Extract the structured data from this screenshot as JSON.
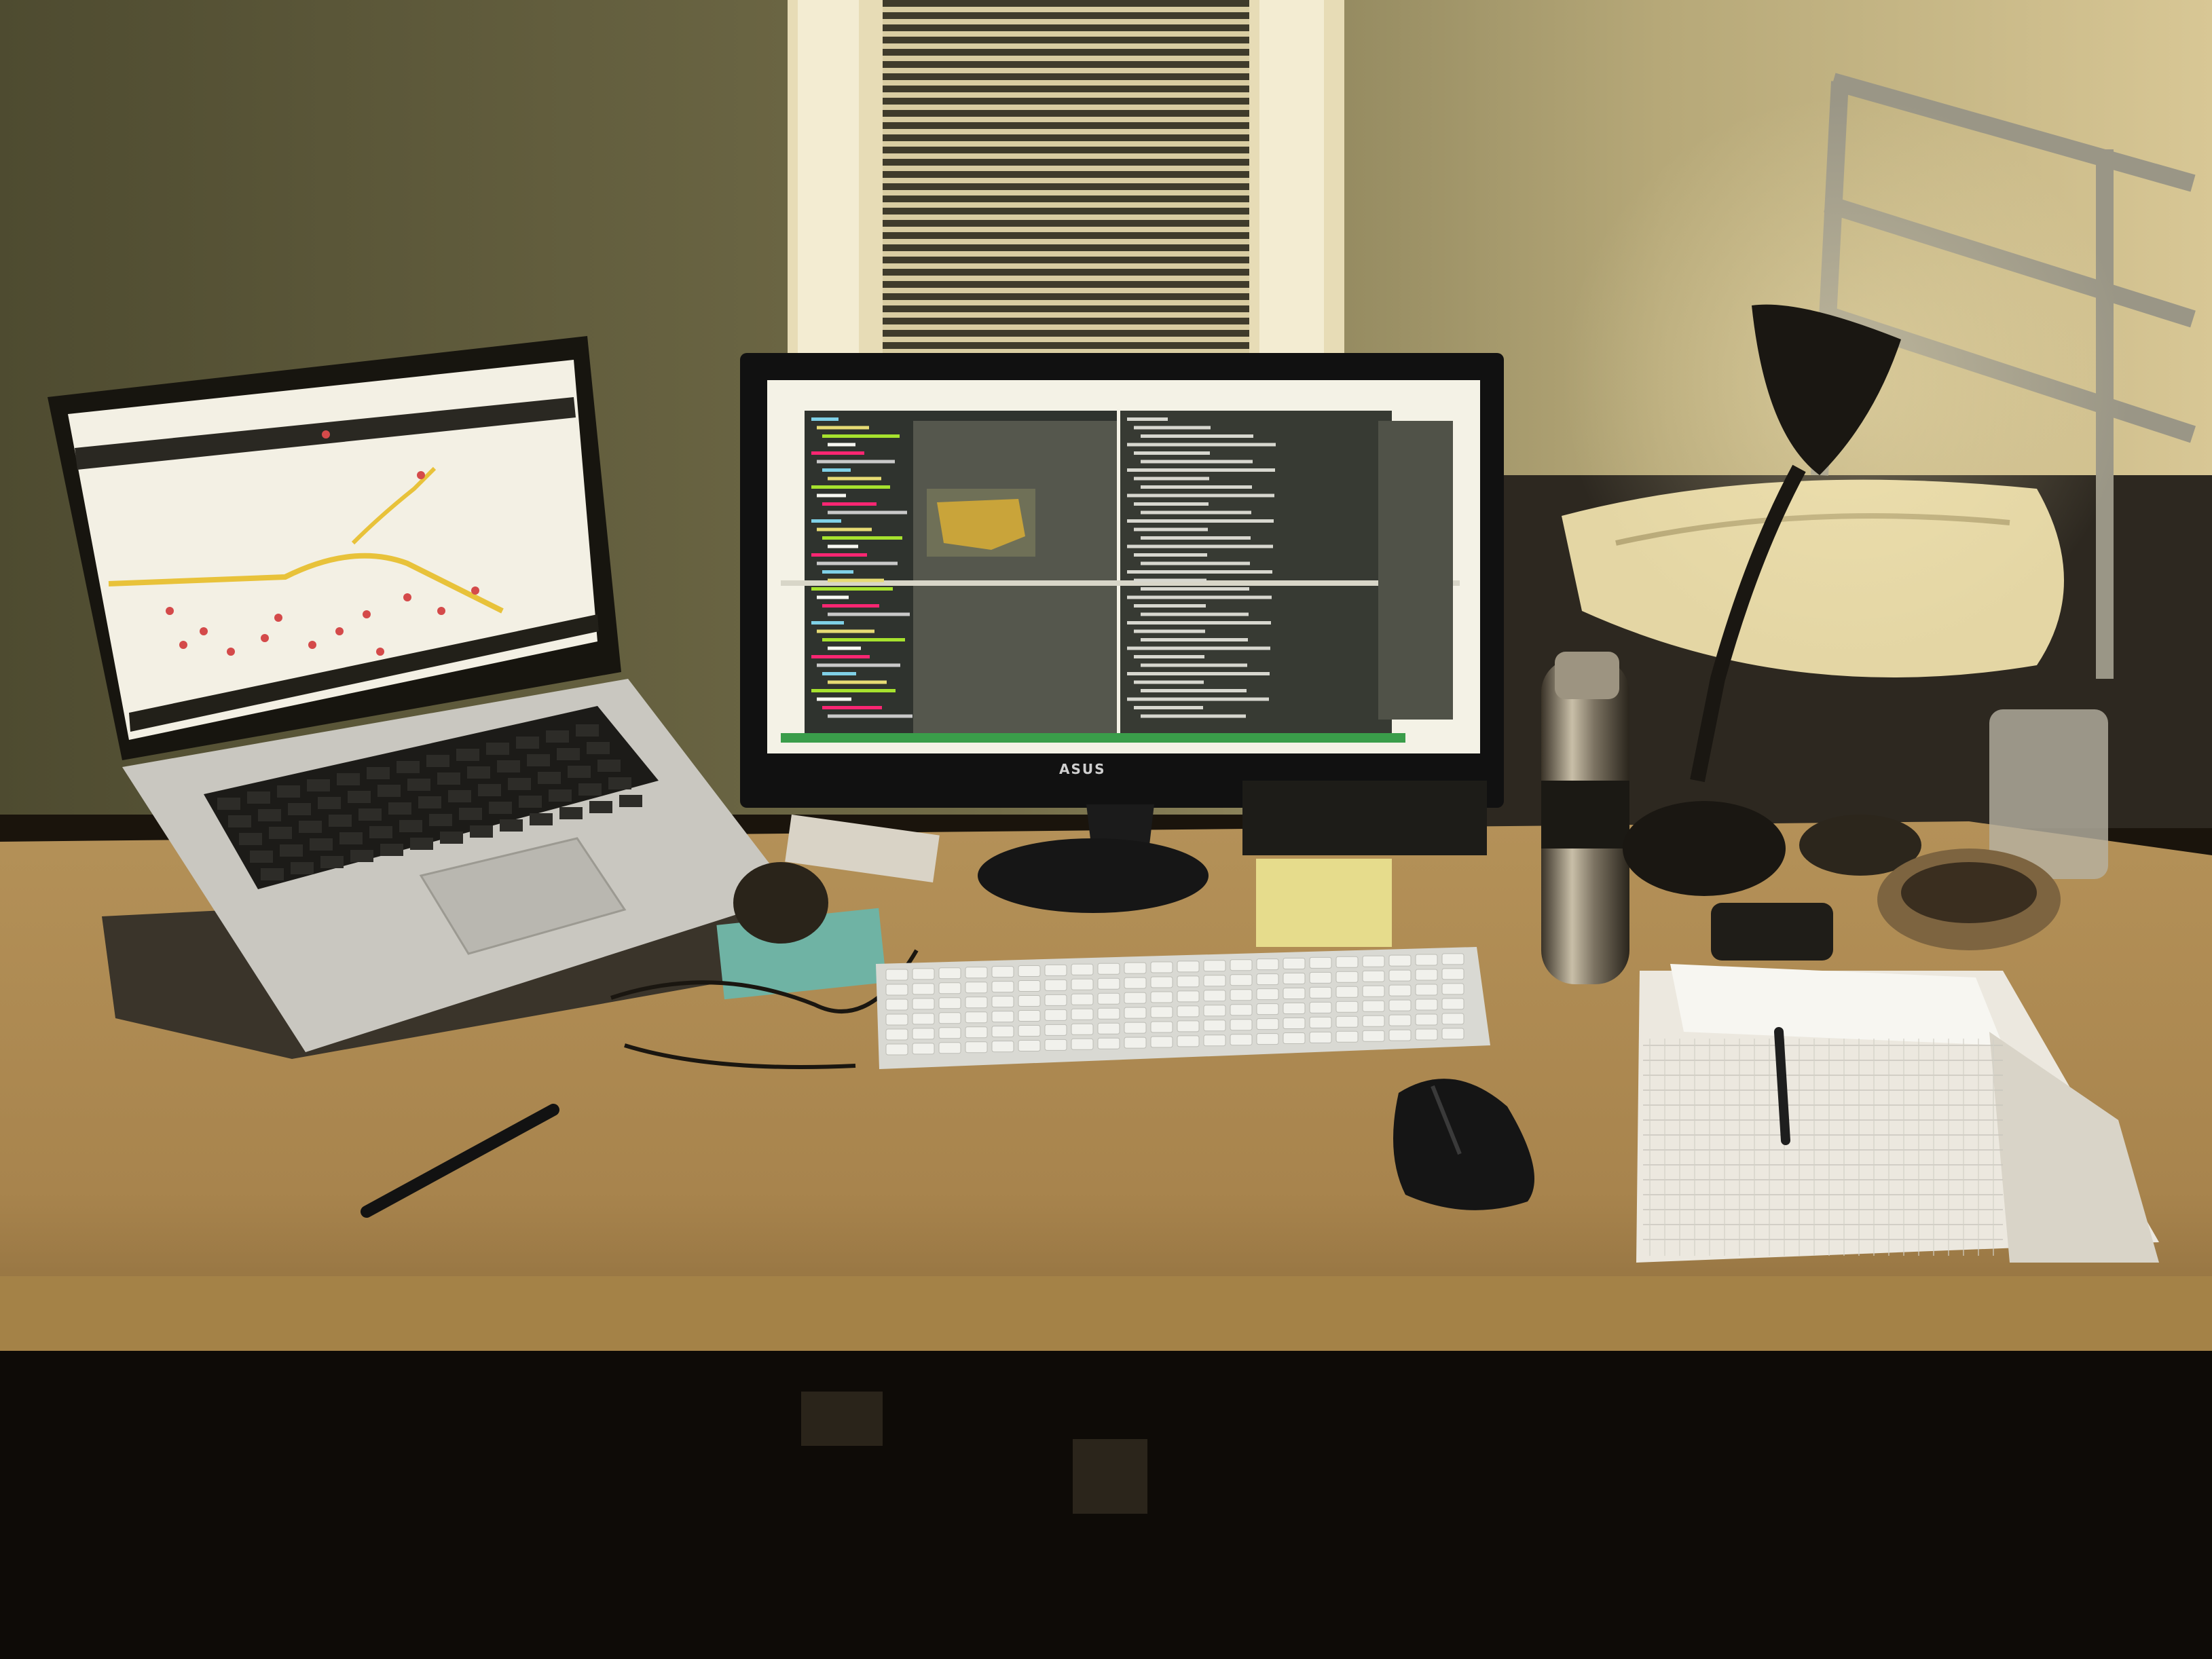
{
  "scene": {
    "monitor": {
      "brand_label": "ASUS"
    }
  },
  "colors": {
    "wall": "#6f6b47",
    "wall_light": "#c9b98a",
    "desk": "#b8955e",
    "desk_shadow": "#6b5230",
    "screen_glow": "#f4f2e6",
    "editor_bg": "#3c3f3a",
    "map_route": "#e8c23a",
    "map_points": "#d44a4a",
    "under_desk": "#0c0a07"
  },
  "icons": {
    "pen": "pen-icon",
    "mouse": "mouse-icon",
    "lamp": "desk-lamp-icon"
  }
}
